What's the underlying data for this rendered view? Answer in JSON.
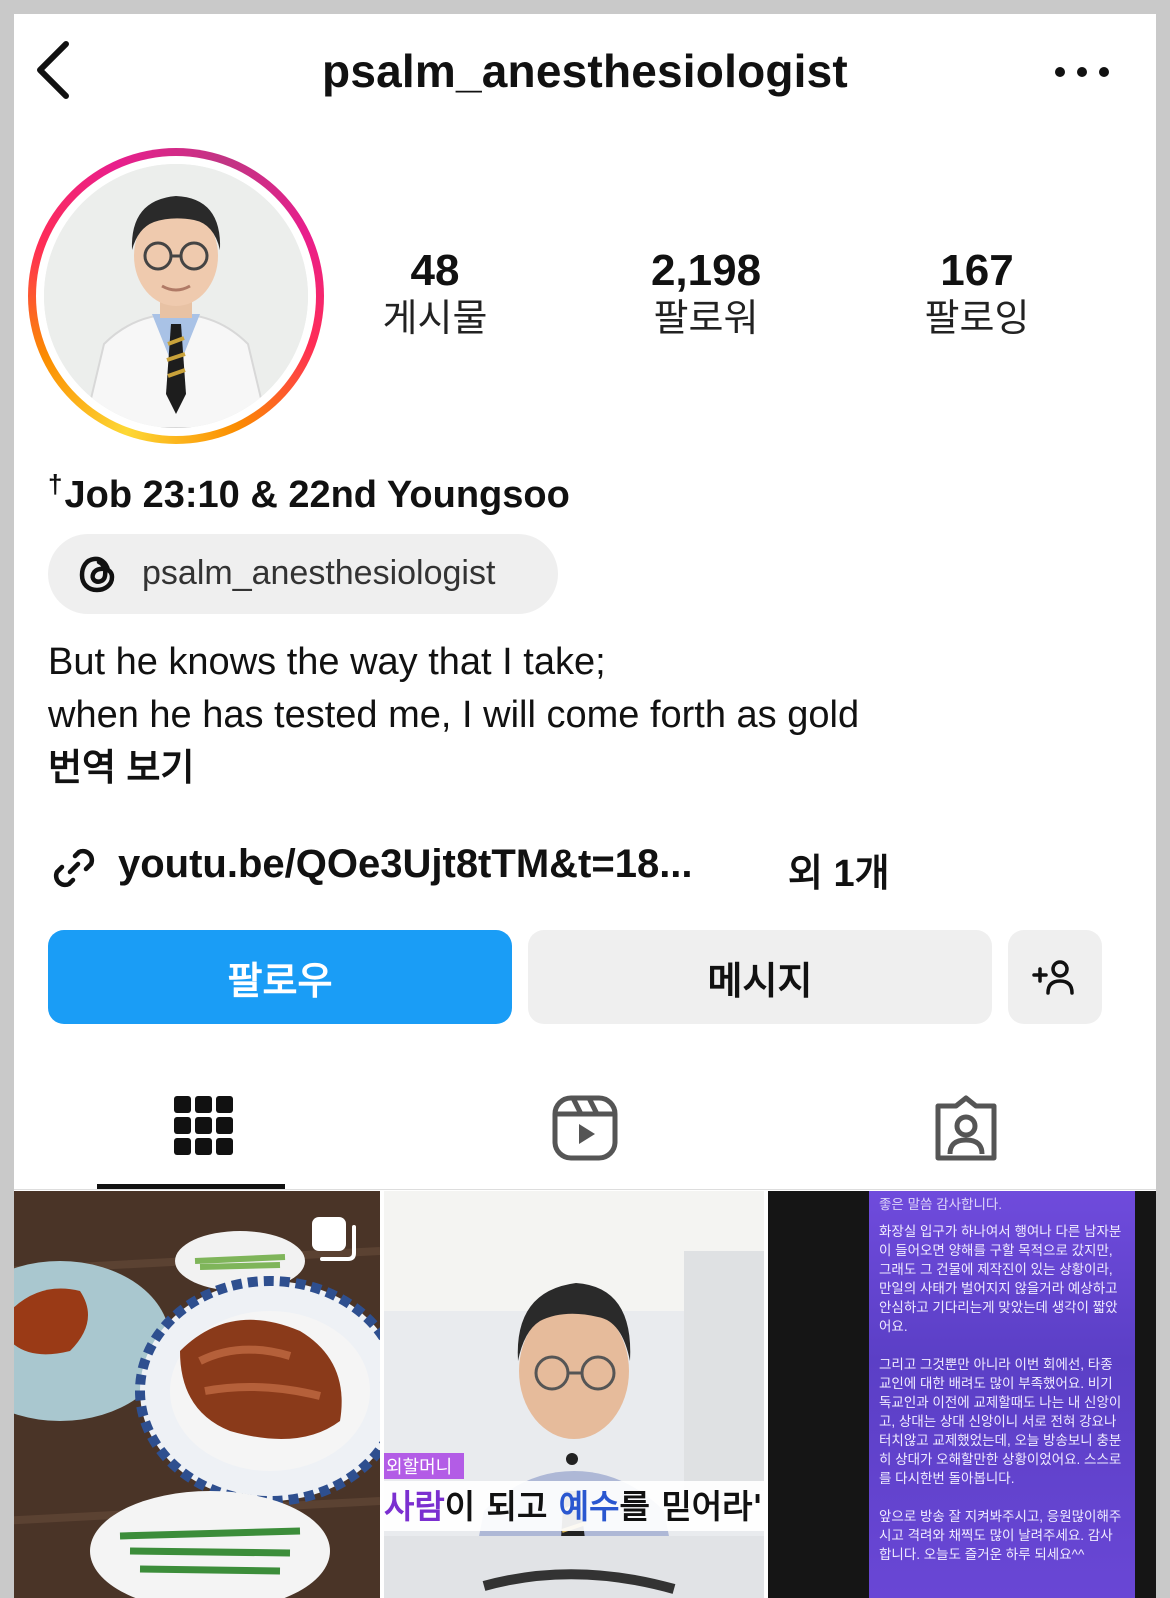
{
  "header": {
    "username": "psalm_anesthesiologist"
  },
  "stats": [
    {
      "value": "48",
      "label": "게시물"
    },
    {
      "value": "2,198",
      "label": "팔로워"
    },
    {
      "value": "167",
      "label": "팔로잉"
    }
  ],
  "profile": {
    "cross": "†",
    "display_name": "Job 23:10 & 22nd Youngsoo",
    "threads_handle": "psalm_anesthesiologist",
    "bio_line1": "But he knows the way that I take;",
    "bio_line2": "when he has tested me, I will come forth as gold",
    "translate_label": "번역 보기",
    "link_text": "youtu.be/QOe3Ujt8tTM&t=18...",
    "link_more": "외 1개"
  },
  "actions": {
    "follow_label": "팔로우",
    "message_label": "메시지"
  },
  "posts": [
    {
      "type": "carousel",
      "icon": "carousel-icon"
    },
    {
      "caption_pre": "사람",
      "caption_mid": "이 되고 ",
      "caption_hl": "예수",
      "caption_post": "를 믿어라'",
      "tag": "외할머니"
    },
    {
      "text_top": "좋은 말씀 감사합니다.",
      "para1": "화장실 입구가 하나여서 행여나 다른 남자분이 들어오면 양해를 구할 목적으로 갔지만, 그래도 그 건물에 제작진이 있는 상황이라, 만일의 사태가 벌어지지 않을거라 예상하고 안심하고 기다리는게 맞았는데 생각이 짧았어요.",
      "para2": "그리고 그것뿐만 아니라 이번 회에선, 타종교인에 대한 배려도 많이 부족했어요. 비기독교인과 이전에 교제할때도 나는 내 신앙이고, 상대는 상대 신앙이니 서로 전혀 강요나 터치않고 교제했었는데, 오늘 방송보니 충분히 상대가 오해할만한 상황이었어요. 스스로를 다시한번 돌아봅니다.",
      "para3": "앞으로 방송 잘 지켜봐주시고, 응원많이해주시고 격려와 채찍도 많이 날려주세요. 감사합니다. 오늘도 즐거운 하루 되세요^^"
    }
  ],
  "colors": {
    "follow_button": "#1a9df6",
    "secondary_button": "#efefef"
  }
}
